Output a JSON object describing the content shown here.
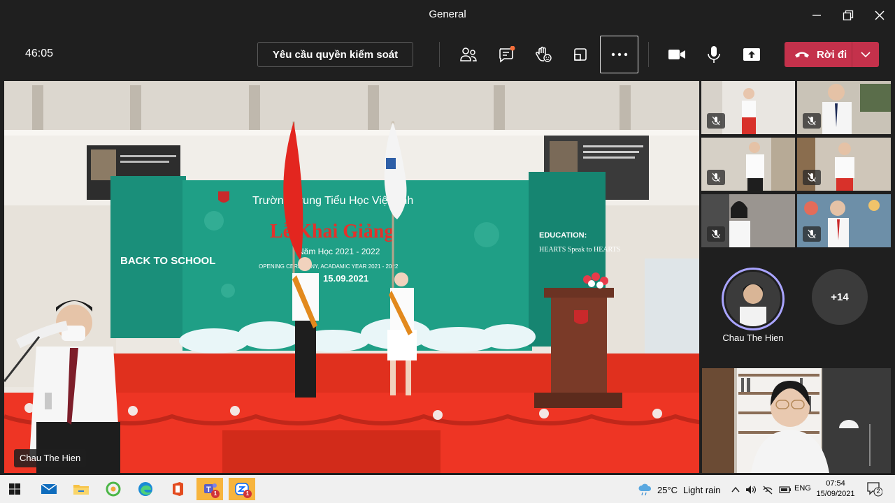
{
  "window": {
    "title": "General"
  },
  "toolbar": {
    "timer": "46:05",
    "request_control_label": "Yêu cầu quyền kiểm soát",
    "leave_label": "Rời đi",
    "accent_color": "#c4314b"
  },
  "stage": {
    "school_name": "Trường Trung Tiểu Học Việt Anh",
    "ceremony_title": "Lễ Khai Giảng",
    "school_year": "Năm Học 2021 - 2022",
    "subtitle": "OPENING CEREMONY, ACADAMIC YEAR 2021 - 2022",
    "date": "15.09.2021",
    "left_banner": "BACK TO SCHOOL",
    "right_banner_title": "EDUCATION:",
    "right_banner_text": "HEARTS Speak to HEARTS",
    "presenter_name": "Chau The Hien"
  },
  "participants": {
    "avatar_name": "Chau The Hien",
    "overflow_count": "+14"
  },
  "taskbar": {
    "temperature": "25°C",
    "weather": "Light rain",
    "language": "ENG",
    "time": "07:54",
    "date": "15/09/2021",
    "notification_count": "2",
    "teams_badge": "1",
    "zalo_badge": "1"
  }
}
